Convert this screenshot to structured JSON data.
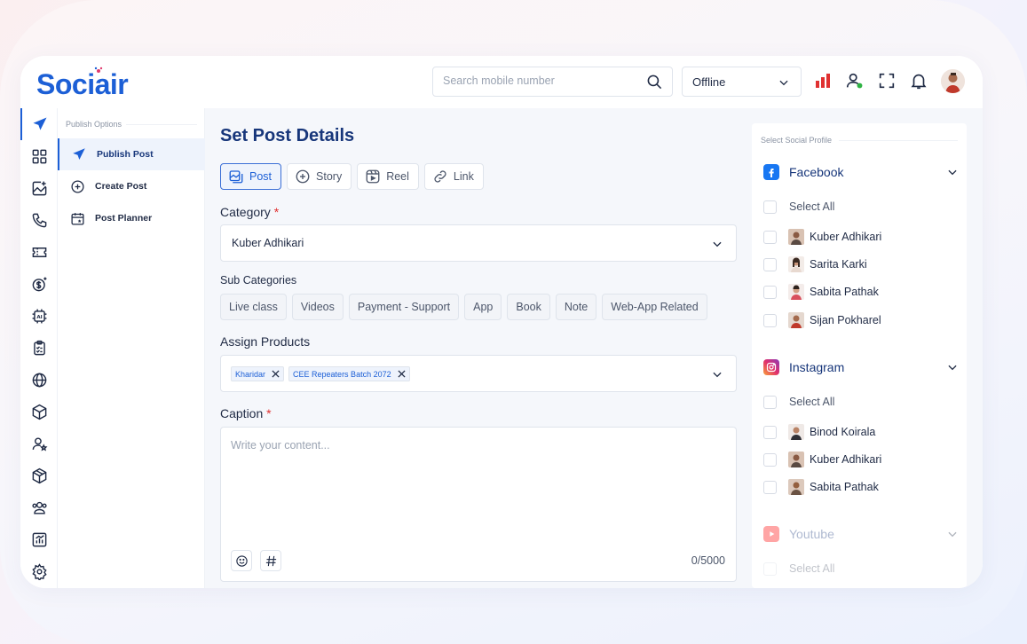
{
  "brand": {
    "name": "Sociair",
    "color": "#1c5fd6"
  },
  "header": {
    "search_placeholder": "Search mobile number",
    "status_value": "Offline",
    "icons": [
      "bar-chart-icon",
      "user-status-icon",
      "fullscreen-icon",
      "bell-icon",
      "avatar"
    ]
  },
  "rail_icons": [
    "send-icon",
    "grid-icon",
    "image-add-icon",
    "phone-icon",
    "ticket-icon",
    "dollar-add-icon",
    "ai-chip-icon",
    "clipboard-icon",
    "globe-icon",
    "box-icon",
    "user-star-icon",
    "package-icon",
    "users-icon",
    "chart-icon",
    "gear-icon"
  ],
  "subnav": {
    "title": "Publish Options",
    "items": [
      {
        "label": "Publish Post",
        "icon": "send-icon",
        "active": true
      },
      {
        "label": "Create Post",
        "icon": "plus-circle-icon",
        "active": false
      },
      {
        "label": "Post Planner",
        "icon": "calendar-icon",
        "active": false
      }
    ]
  },
  "main": {
    "title": "Set Post Details",
    "tabs": [
      {
        "label": "Post",
        "icon": "post-icon",
        "active": true
      },
      {
        "label": "Story",
        "icon": "plus-circle-icon",
        "active": false
      },
      {
        "label": "Reel",
        "icon": "reel-icon",
        "active": false
      },
      {
        "label": "Link",
        "icon": "link-icon",
        "active": false
      }
    ],
    "category_label": "Category",
    "required_mark": "*",
    "category_value": "Kuber Adhikari",
    "subcategories_label": "Sub Categories",
    "subcategories": [
      "Live class",
      "Videos",
      "Payment - Support",
      "App",
      "Book",
      "Note",
      "Web-App Related"
    ],
    "assign_products_label": "Assign Products",
    "products": [
      "Kharidar",
      "CEE Repeaters Batch 2072"
    ],
    "caption_label": "Caption",
    "caption_placeholder": "Write your content...",
    "caption_counter": "0/5000"
  },
  "profiles": {
    "title": "Select Social Profile",
    "select_all": "Select All",
    "networks": [
      {
        "name": "Facebook",
        "color": "#1877f2",
        "accounts": [
          "Kuber Adhikari",
          "Sarita Karki",
          "Sabita Pathak",
          "Sijan Pokharel"
        ]
      },
      {
        "name": "Instagram",
        "color": "#d62976",
        "accounts": [
          "Binod Koirala",
          "Kuber Adhikari",
          "Sabita Pathak"
        ]
      },
      {
        "name": "Youtube",
        "color": "#ff0000",
        "accounts": []
      }
    ]
  }
}
